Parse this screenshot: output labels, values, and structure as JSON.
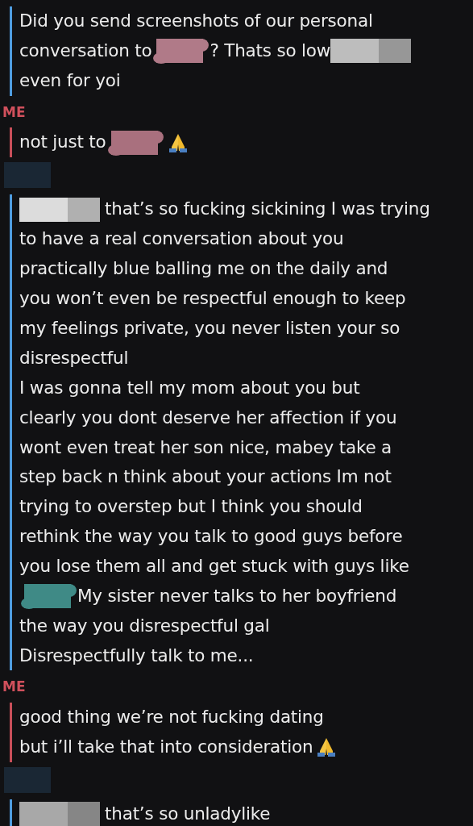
{
  "messages": [
    {
      "kind": "incoming",
      "lines": [
        [
          {
            "kind": "text",
            "text": "Did you send screenshots of our personal"
          }
        ],
        [
          {
            "kind": "text",
            "text": "conversation to"
          },
          {
            "kind": "scribble",
            "color": "#b07a88"
          },
          {
            "kind": "text",
            "text": "? Thats so low"
          },
          {
            "kind": "blur",
            "color": "#bdbdbd"
          }
        ],
        [
          {
            "kind": "text",
            "text": "even for yoi"
          }
        ]
      ]
    },
    {
      "kind": "outgoing",
      "header": {
        "kind": "label",
        "text": "ME"
      },
      "lines": [
        [
          {
            "kind": "text",
            "text": "not just to"
          },
          {
            "kind": "scribble",
            "color": "#a9707e"
          },
          {
            "kind": "emoji"
          }
        ]
      ]
    },
    {
      "kind": "incoming",
      "header": {
        "kind": "redacted"
      },
      "lines": [
        [
          {
            "kind": "blur",
            "color": "#dcdcdc"
          },
          {
            "kind": "text",
            "text": "that’s so fucking sickining I was trying"
          }
        ],
        [
          {
            "kind": "text",
            "text": "to have a real conversation about you"
          }
        ],
        [
          {
            "kind": "text",
            "text": "practically blue balling me on the daily and"
          }
        ],
        [
          {
            "kind": "text",
            "text": "you won’t even be respectful enough to keep"
          }
        ],
        [
          {
            "kind": "text",
            "text": "my feelings private, you never listen your so"
          }
        ],
        [
          {
            "kind": "text",
            "text": "disrespectful"
          }
        ],
        [
          {
            "kind": "text",
            "text": "I was gonna tell my mom about you but"
          }
        ],
        [
          {
            "kind": "text",
            "text": "clearly you dont deserve her affection if you"
          }
        ],
        [
          {
            "kind": "text",
            "text": "wont even treat her son nice, mabey take a"
          }
        ],
        [
          {
            "kind": "text",
            "text": "step back n think about your actions Im not"
          }
        ],
        [
          {
            "kind": "text",
            "text": "trying to overstep but I think you should"
          }
        ],
        [
          {
            "kind": "text",
            "text": "rethink the way you talk to good guys before"
          }
        ],
        [
          {
            "kind": "text",
            "text": "you lose them all and get stuck with guys like"
          }
        ],
        [
          {
            "kind": "scribble",
            "color": "#3f8a86"
          },
          {
            "kind": "text",
            "text": "My sister never talks to her boyfriend"
          }
        ],
        [
          {
            "kind": "text",
            "text": "the way you disrespectful gal"
          }
        ],
        [
          {
            "kind": "text",
            "text": "Disrespectfully talk to me..."
          }
        ]
      ]
    },
    {
      "kind": "outgoing",
      "header": {
        "kind": "label",
        "text": "ME"
      },
      "lines": [
        [
          {
            "kind": "text",
            "text": "good thing we’re not fucking dating"
          }
        ],
        [
          {
            "kind": "text",
            "text": "but i’ll take that into consideration"
          },
          {
            "kind": "emoji"
          }
        ]
      ]
    },
    {
      "kind": "incoming",
      "header": {
        "kind": "redacted"
      },
      "lines": [
        [
          {
            "kind": "blur",
            "color": "#a8a8a8"
          },
          {
            "kind": "text",
            "text": "that’s so unladylike"
          }
        ]
      ]
    }
  ]
}
